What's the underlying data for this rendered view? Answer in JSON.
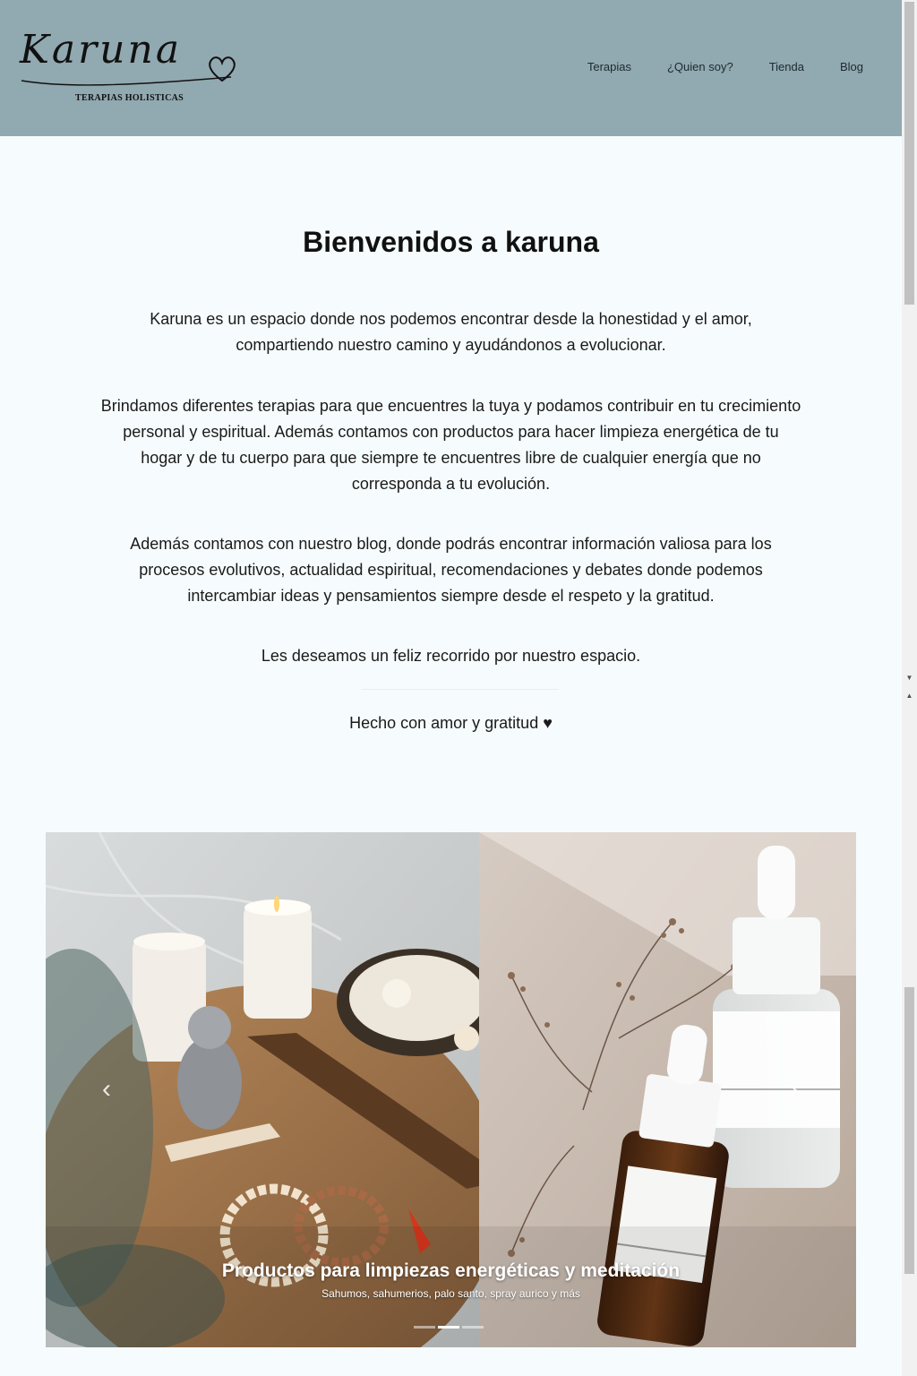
{
  "header": {
    "logo": {
      "script_text": "Karuna",
      "subtitle": "TERAPIAS HOLISTICAS"
    },
    "nav": [
      {
        "label": "Terapias"
      },
      {
        "label": "¿Quien soy?"
      },
      {
        "label": "Tienda"
      },
      {
        "label": "Blog"
      }
    ],
    "background_color": "#91a9b0"
  },
  "main": {
    "title": "Bienvenidos a karuna",
    "paragraphs": [
      "Karuna es un espacio donde nos podemos encontrar desde la honestidad y el amor, compartiendo nuestro camino y ayudándonos a evolucionar.",
      "Brindamos diferentes terapias para que encuentres la tuya y podamos contribuir en tu crecimiento personal y espiritual. Además contamos con productos para hacer limpieza energética de tu hogar y de tu cuerpo para que siempre te encuentres libre de cualquier energía que no corresponda a tu evolución.",
      "Además contamos con nuestro blog, donde podrás encontrar información valiosa para los procesos evolutivos, actualidad espiritual, recomendaciones y debates donde podemos intercambiar ideas y pensamientos siempre desde el respeto y la gratitud.",
      "Les deseamos un feliz recorrido por nuestro espacio."
    ],
    "signature": "Hecho con amor y gratitud ♥"
  },
  "carousel": {
    "slide_title": "Productos para limpiezas energéticas y meditación",
    "slide_subtitle": "Sahumos, sahumerios, palo santo, spray aurico y más",
    "prev_icon": "‹",
    "next_icon": "›",
    "indicator_count": 3,
    "active_indicator": 2
  },
  "colors": {
    "page_background": "#f6fcfd",
    "header": "#91a9b0"
  }
}
